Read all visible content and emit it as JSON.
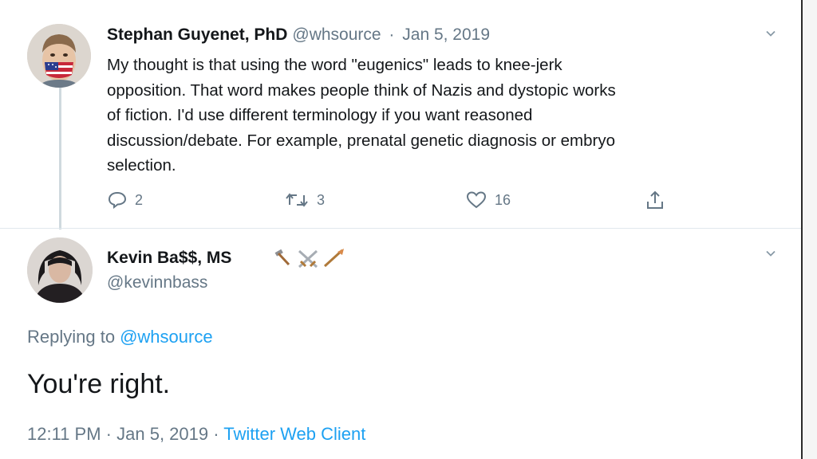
{
  "tweets": [
    {
      "author_name": "Stephan Guyenet, PhD",
      "handle": "@whsource",
      "separator": "·",
      "date": "Jan 5, 2019",
      "body": "My thought is that using the word \"eugenics\" leads to knee-jerk\nopposition.  That word makes people think of Nazis and dystopic works\nof fiction.  I'd use different terminology if you want reasoned\ndiscussion/debate.  For example, prenatal genetic diagnosis or embryo\nselection.",
      "actions": {
        "reply_count": "2",
        "retweet_count": "3",
        "like_count": "16"
      }
    }
  ],
  "focused_tweet": {
    "author_name": "Kevin Ba$$, MS",
    "handle": "@kevinnbass",
    "replying_label": "Replying to",
    "replying_to": "@whsource",
    "text": "You're right.",
    "time": "12:11 PM",
    "separator": "·",
    "date": "Jan 5, 2019",
    "separator2": "·",
    "client": "Twitter Web Client"
  },
  "icons": {
    "reply": "reply-icon",
    "retweet": "retweet-icon",
    "like": "heart-icon",
    "share": "share-icon",
    "chevron": "chevron-down-icon",
    "flag_mask": "us-flag-mask"
  },
  "colors": {
    "text": "#14171a",
    "secondary": "#657786",
    "link": "#1da1f2",
    "border": "#e1e8ed"
  }
}
